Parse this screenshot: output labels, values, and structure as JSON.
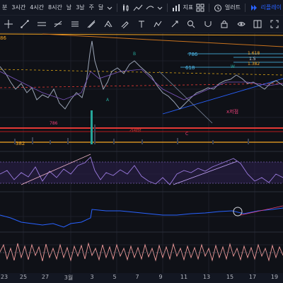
{
  "toolbar": {
    "timeframes": [
      "분",
      "3시간",
      "4시간",
      "8시간",
      "날",
      "3날",
      "주",
      "달"
    ],
    "indicators_label": "지표",
    "alert_label": "얼러트",
    "replay_label": "리플레이"
  },
  "drawing_tools": [
    "crosshair-icon",
    "trend-line-icon",
    "horizontal-line-icon",
    "ray-icon",
    "channel-icon",
    "fib-icon",
    "pitchfork-icon",
    "brush-icon",
    "text-icon",
    "pattern-icon",
    "measure-icon",
    "zoom-icon",
    "magnet-icon",
    "lock-icon",
    "eye-icon",
    "layout-icon",
    "fullscreen-icon"
  ],
  "chart_text": {
    "top_left_label": "86",
    "label_786_upper": "786",
    "label_618": "618",
    "label_1618": "1.618",
    "label_15": "1.5",
    "label_1382": "1.382",
    "label_w": "W",
    "label_a": "A",
    "label_b": "B",
    "label_c": "C",
    "label_786_lower": "786",
    "label_382": "382",
    "label_xlow": "x저점",
    "label_red_box": "거래량"
  },
  "x_axis": {
    "labels": [
      "23",
      "25",
      "27",
      "3월",
      "3",
      "5",
      "7",
      "9",
      "11",
      "13",
      "15",
      "17",
      "19"
    ]
  },
  "colors": {
    "background": "#0f1117",
    "orange_line": "#f5a623",
    "red_line": "#e53935",
    "blue_line": "#2962ff",
    "purple_line": "#7e57c2",
    "pink_line": "#ec407a",
    "fib_label": "#4fc3f7"
  }
}
